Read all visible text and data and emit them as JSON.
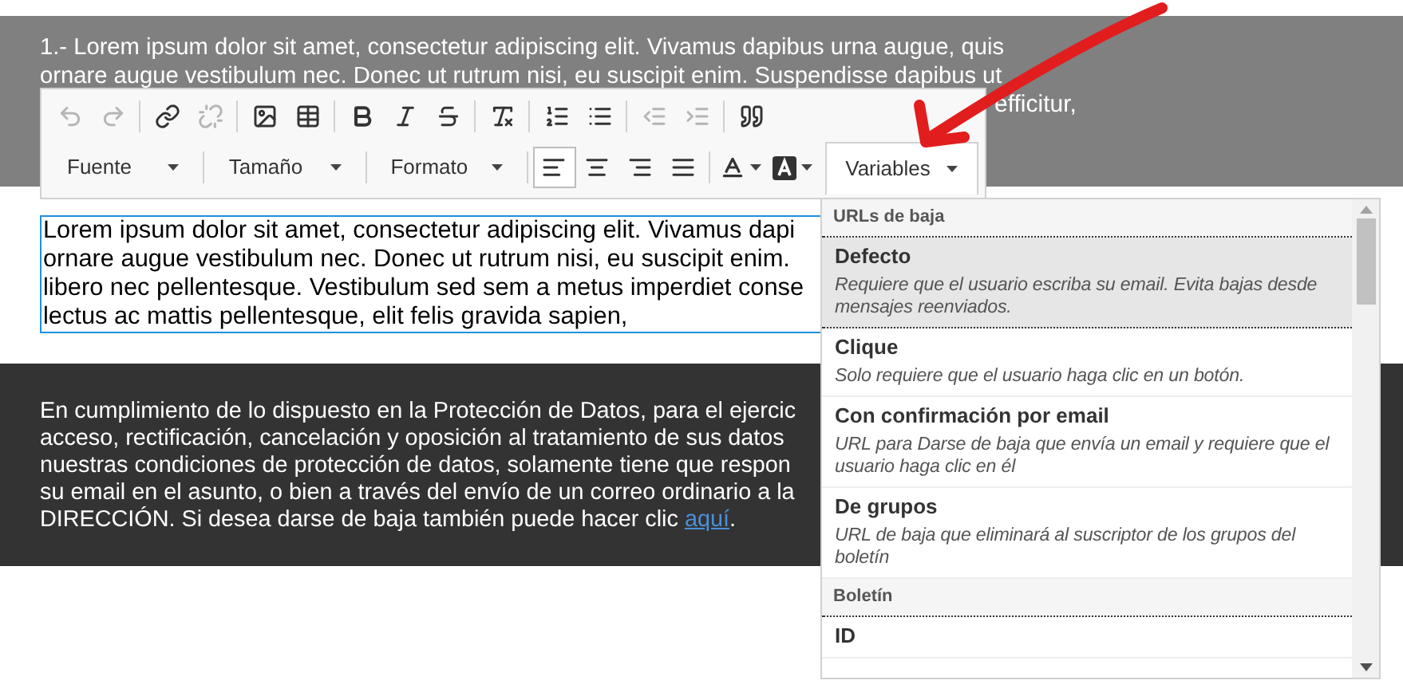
{
  "header": {
    "lines": [
      "1.- Lorem ipsum dolor sit amet, consectetur adipiscing elit. Vivamus dapibus urna augue, quis",
      "ornare augue vestibulum nec. Donec ut rutrum nisi, eu suscipit enim. Suspendisse dapibus ut",
      "efficitur,"
    ]
  },
  "toolbar": {
    "row_1": [
      [
        {
          "kind": "undo",
          "disabled": true
        },
        {
          "kind": "redo",
          "disabled": true
        }
      ],
      [
        {
          "kind": "link",
          "disabled": false
        },
        {
          "kind": "unlink",
          "disabled": true
        }
      ],
      [
        {
          "kind": "image",
          "disabled": false
        },
        {
          "kind": "table",
          "disabled": false
        }
      ],
      [
        {
          "kind": "bold",
          "disabled": false
        },
        {
          "kind": "italic",
          "disabled": false
        },
        {
          "kind": "strike",
          "disabled": false
        }
      ],
      [
        {
          "kind": "clear",
          "disabled": false
        }
      ],
      [
        {
          "kind": "numbered",
          "disabled": false
        },
        {
          "kind": "bulleted",
          "disabled": false
        }
      ],
      [
        {
          "kind": "outdent",
          "disabled": true
        },
        {
          "kind": "indent",
          "disabled": true
        }
      ],
      [
        {
          "kind": "quote",
          "disabled": false
        }
      ]
    ],
    "combos": [
      {
        "label": "Fuente"
      },
      {
        "label": "Tamaño"
      },
      {
        "label": "Formato"
      }
    ],
    "align_buttons": [
      {
        "kind": "left",
        "selected": true
      },
      {
        "kind": "center",
        "selected": false
      },
      {
        "kind": "right",
        "selected": false
      },
      {
        "kind": "justify",
        "selected": false
      }
    ],
    "color_buttons": [
      {
        "kind": "text"
      },
      {
        "kind": "background"
      }
    ],
    "variables": {
      "label": "Variables",
      "expanded": true
    }
  },
  "editor": {
    "lines": [
      "Lorem ipsum dolor sit amet, consectetur adipiscing elit. Vivamus dapi",
      "ornare augue vestibulum nec. Donec ut rutrum nisi, eu suscipit enim.",
      "libero nec pellentesque. Vestibulum sed sem a metus imperdiet conse",
      "lectus ac mattis pellentesque, elit felis gravida sapien,"
    ]
  },
  "footer": {
    "lines": [
      "En cumplimiento de lo dispuesto en la Protección de Datos, para el ejercic",
      "acceso, rectificación, cancelación y oposición al tratamiento de sus datos",
      "nuestras condiciones de protección de datos, solamente tiene que respon",
      "su email en el asunto, o bien a través del envío de un correo ordinario a la",
      "DIRECCIÓN. Si desea darse de baja también puede hacer clic "
    ],
    "link": "aquí",
    "end": "."
  },
  "dropdown": {
    "items": [
      {
        "kind": "header",
        "label": "URLs de baja"
      },
      {
        "kind": "option",
        "title": "Defecto",
        "description": "Requiere que el usuario escriba su email. Evita bajas desde mensajes reenviados.",
        "selected": true
      },
      {
        "kind": "option",
        "title": "Clique",
        "description": "Solo requiere que el usuario haga clic en un botón.",
        "selected": false
      },
      {
        "kind": "option",
        "title": "Con confirmación por email",
        "description": "URL para Darse de baja que envía un email y requiere que el usuario haga clic en él",
        "selected": false
      },
      {
        "kind": "option",
        "title": "De grupos",
        "description": "URL de baja que eliminará al suscriptor de los grupos del boletín",
        "selected": false
      },
      {
        "kind": "header",
        "label": "Boletín"
      },
      {
        "kind": "option",
        "title": "ID",
        "selected": false
      }
    ]
  }
}
